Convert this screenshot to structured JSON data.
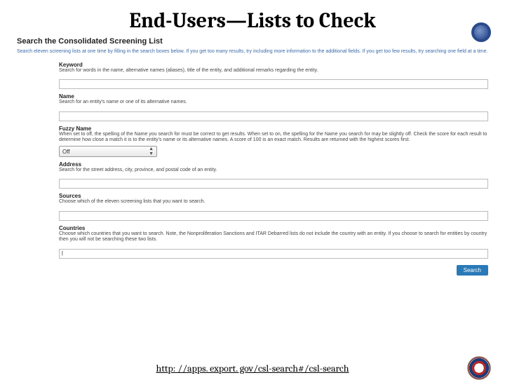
{
  "slide_title": "End-Users—Lists to Check",
  "page": {
    "title": "Search the Consolidated Screening List",
    "subtitle": "Search eleven screening lists at one time by filling in the search boxes below. If you get too many results, try including more information to the additional fields. If you get too few results, try searching one field at a time."
  },
  "fields": {
    "keyword": {
      "label": "Keyword",
      "help": "Search for words in the name, alternative names (aliases), title of the entity, and additional remarks regarding the entity."
    },
    "name_f": {
      "label": "Name",
      "help": "Search for an entity's name or one of its alternative names."
    },
    "fuzzy": {
      "label": "Fuzzy Name",
      "help": "When set to off, the spelling of the Name you search for must be correct to get results. When set to on, the spelling for the Name you search for may be slightly off. Check the score for each result to determine how close a match it is to the entity's name or its alternative names. A score of 100 is an exact match. Results are returned with the highest scores first.",
      "value": "Off"
    },
    "address": {
      "label": "Address",
      "help": "Search for the street address, city, province, and postal code of an entity."
    },
    "sources": {
      "label": "Sources",
      "help": "Choose which of the eleven screening lists that you want to search."
    },
    "countries": {
      "label": "Countries",
      "help": "Choose which countries that you want to search.\nNote, the Nonproliferation Sanctions and ITAR Debarred lists do not include the country with an entity. If you choose to search for entities by country then you will not be searching these two lists.",
      "value": "|"
    }
  },
  "search_label": "Search",
  "footer_url": "http: //apps. export. gov/csl-search#/csl-search"
}
